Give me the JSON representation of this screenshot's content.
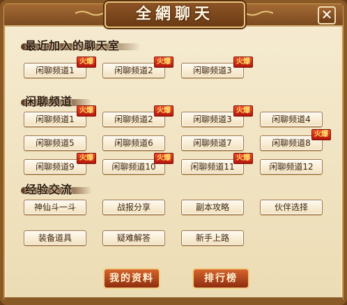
{
  "window": {
    "title": "全網聊天",
    "close_label": "✕"
  },
  "sections": {
    "recent": {
      "title": "最近加入的聊天室"
    },
    "casual": {
      "title": "闲聊频道"
    },
    "exp": {
      "title": "经验交流"
    }
  },
  "recent_channels": [
    {
      "label": "闲聊频道1",
      "badge": "火爆"
    },
    {
      "label": "闲聊频道2",
      "badge": "火爆"
    },
    {
      "label": "闲聊频道3",
      "badge": "火爆"
    }
  ],
  "casual_channels": [
    {
      "label": "闲聊频道1",
      "badge": "火爆"
    },
    {
      "label": "闲聊频道2",
      "badge": "火爆"
    },
    {
      "label": "闲聊频道3",
      "badge": "火爆"
    },
    {
      "label": "闲聊频道4",
      "badge": ""
    },
    {
      "label": "闲聊频道5",
      "badge": ""
    },
    {
      "label": "闲聊频道6",
      "badge": ""
    },
    {
      "label": "闲聊频道7",
      "badge": ""
    },
    {
      "label": "闲聊频道8",
      "badge": "火爆"
    },
    {
      "label": "闲聊频道9",
      "badge": "火爆"
    },
    {
      "label": "闲聊频道10",
      "badge": "火爆"
    },
    {
      "label": "闲聊频道11",
      "badge": "火爆"
    },
    {
      "label": "闲聊频道12",
      "badge": ""
    }
  ],
  "exp_channels": [
    {
      "label": "神仙斗一斗"
    },
    {
      "label": "战报分享"
    },
    {
      "label": "副本攻略"
    },
    {
      "label": "伙伴选择"
    },
    {
      "label": "装备道具"
    },
    {
      "label": "疑难解答"
    },
    {
      "label": "新手上路"
    }
  ],
  "actions": {
    "profile": "我的资料",
    "ranking": "排行榜"
  },
  "colors": {
    "badge": "#d9261a",
    "action": "#b84a1e",
    "frame": "#8a5a26"
  }
}
